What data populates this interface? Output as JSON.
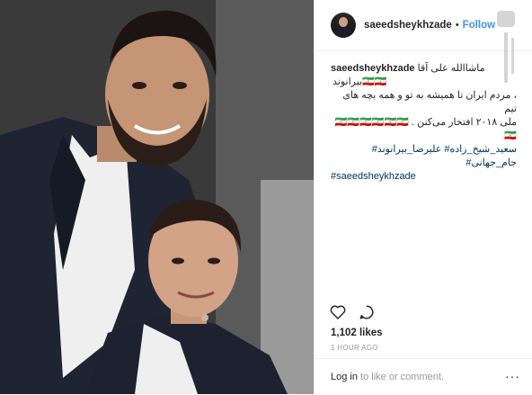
{
  "post": {
    "username": "saeedsheykhzade",
    "follow_label": "Follow",
    "separator": "•",
    "caption": {
      "user": "saeedsheykhzade",
      "line1": "ماشاالله علی آقا بیرانوند🇮🇷🇮🇷",
      "line2": "، مردم ایران تا همیشه به تو و همه بچه های تیم",
      "line3": "ملی ۲۰۱۸ افتخار می‌کنن . 🇮🇷🇮🇷🇮🇷🇮🇷🇮🇷🇮🇷🇮🇷",
      "hashtags_rtl": "سعید_شیخ_زاده# علیرضا_بیرانوند# جام_جهانی#",
      "hashtag_ltr": "#saeedsheykhzade"
    },
    "likes": "1,102 likes",
    "time": "1 HOUR AGO",
    "login_prefix": "Log in",
    "login_suffix": " to like or comment.",
    "more_label": "···"
  },
  "icons": {
    "heart": "heart-icon",
    "comment": "comment-icon",
    "watermark": "mashregh-news-watermark"
  },
  "colors": {
    "follow": "#3897f0",
    "hashtag": "#003569",
    "text": "#262626",
    "muted": "#999999"
  }
}
